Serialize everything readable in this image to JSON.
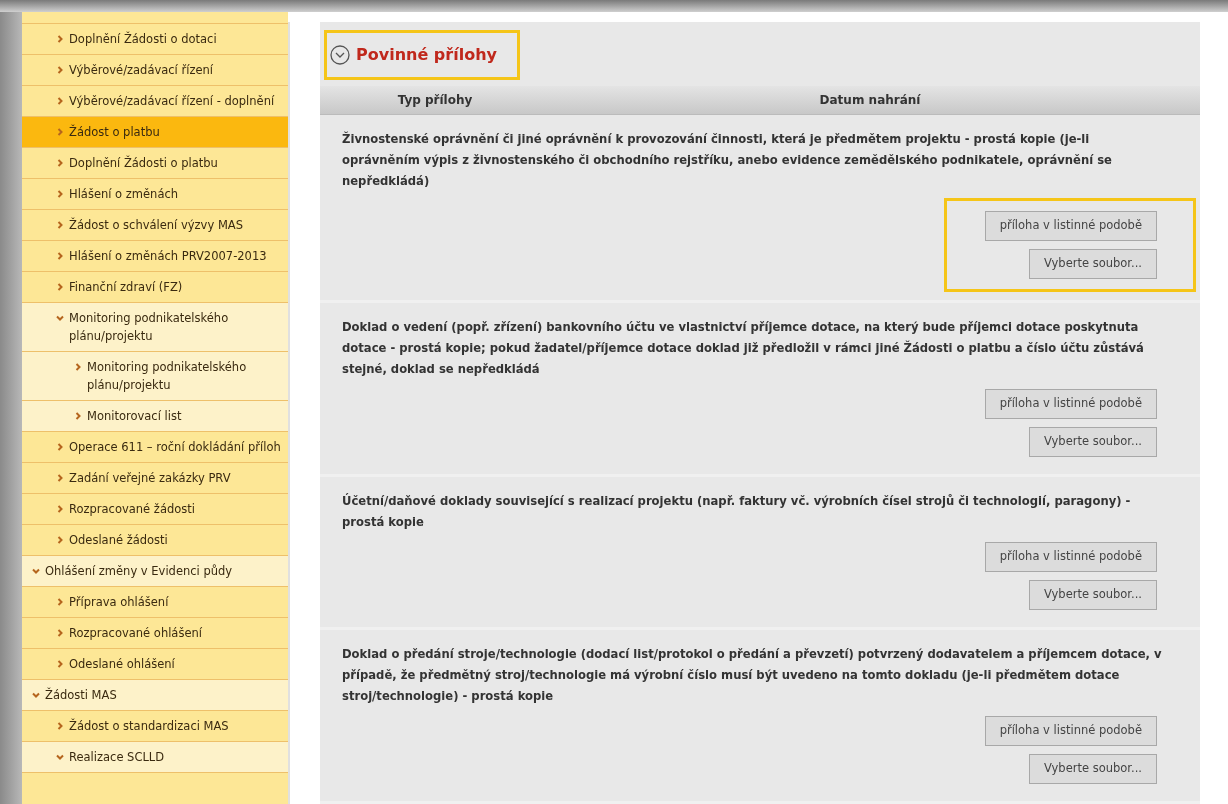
{
  "sidebar": {
    "items": [
      {
        "children": [
          {
            "label": "Doplnění Žádosti o dotaci",
            "selected": false
          },
          {
            "label": "Výběrové/zadávací řízení",
            "selected": false
          },
          {
            "label": "Výběrové/zadávací řízení - doplnění",
            "selected": false
          },
          {
            "label": "Žádost o platbu",
            "selected": true
          },
          {
            "label": "Doplnění Žádosti o platbu",
            "selected": false
          },
          {
            "label": "Hlášení o změnách",
            "selected": false
          },
          {
            "label": "Žádost o schválení výzvy MAS",
            "selected": false
          },
          {
            "label": "Hlášení o změnách PRV2007-2013",
            "selected": false
          },
          {
            "label": "Finanční zdraví (FZ)",
            "selected": false
          },
          {
            "label": "Monitoring podnikatelského plánu/projektu",
            "selected": false,
            "expanded": true,
            "children": [
              {
                "label": "Monitoring podnikatelského plánu/projektu",
                "selected": false
              },
              {
                "label": "Monitorovací list",
                "selected": false
              }
            ]
          },
          {
            "label": "Operace 611 – roční dokládání příloh",
            "selected": false
          },
          {
            "label": "Zadání veřejné zakázky PRV",
            "selected": false
          },
          {
            "label": "Rozpracované žádosti",
            "selected": false
          },
          {
            "label": "Odeslané žádosti",
            "selected": false
          }
        ]
      },
      {
        "label": "Ohlášení změny v Evidenci půdy",
        "selected": false,
        "expanded": true,
        "children": [
          {
            "label": "Příprava ohlášení",
            "selected": false
          },
          {
            "label": "Rozpracované ohlášení",
            "selected": false
          },
          {
            "label": "Odeslané ohlášení",
            "selected": false
          }
        ]
      },
      {
        "label": "Žádosti MAS",
        "selected": false,
        "expanded": true,
        "children": [
          {
            "label": "Žádost o standardizaci MAS",
            "selected": false
          },
          {
            "label": "Realizace SCLLD",
            "selected": false,
            "expanded": true
          }
        ]
      }
    ]
  },
  "panel": {
    "title": "Povinné přílohy",
    "title_highlighted": true,
    "expanded": true,
    "columns": [
      "Typ přílohy",
      "Datum nahrání"
    ],
    "attachments": [
      {
        "text": "Živnostenské oprávnění či jiné oprávnění k provozování činnosti, která je předmětem projektu - prostá kopie (je-li oprávněním výpis z živnostenského či obchodního rejstříku, anebo evidence zemědělského podnikatele, oprávnění se nepředkládá)",
        "highlighted": true,
        "buttons": [
          "příloha v listinné podobě",
          "Vyberte soubor..."
        ]
      },
      {
        "text": "Doklad o vedení (popř. zřízení) bankovního účtu ve vlastnictví příjemce dotace, na který bude příjemci dotace poskytnuta dotace - prostá kopie; pokud žadatel/příjemce dotace doklad již předložil v rámci jiné Žádosti o platbu a číslo účtu zůstává stejné, doklad se nepředkládá",
        "highlighted": false,
        "buttons": [
          "příloha v listinné podobě",
          "Vyberte soubor..."
        ]
      },
      {
        "text": "Účetní/daňové doklady související s realizací projektu (např. faktury vč. výrobních čísel strojů či technologií, paragony) - prostá kopie",
        "highlighted": false,
        "buttons": [
          "příloha v listinné podobě",
          "Vyberte soubor..."
        ]
      },
      {
        "text": "Doklad o předání stroje/technologie (dodací list/protokol o předání a převzetí) potvrzený dodavatelem a příjemcem dotace, v případě, že předmětný stroj/technologie má výrobní číslo musí být uvedeno na tomto dokladu (je-li předmětem dotace stroj/technologie) - prostá kopie",
        "highlighted": false,
        "buttons": [
          "příloha v listinné podobě",
          "Vyberte soubor..."
        ]
      }
    ]
  }
}
